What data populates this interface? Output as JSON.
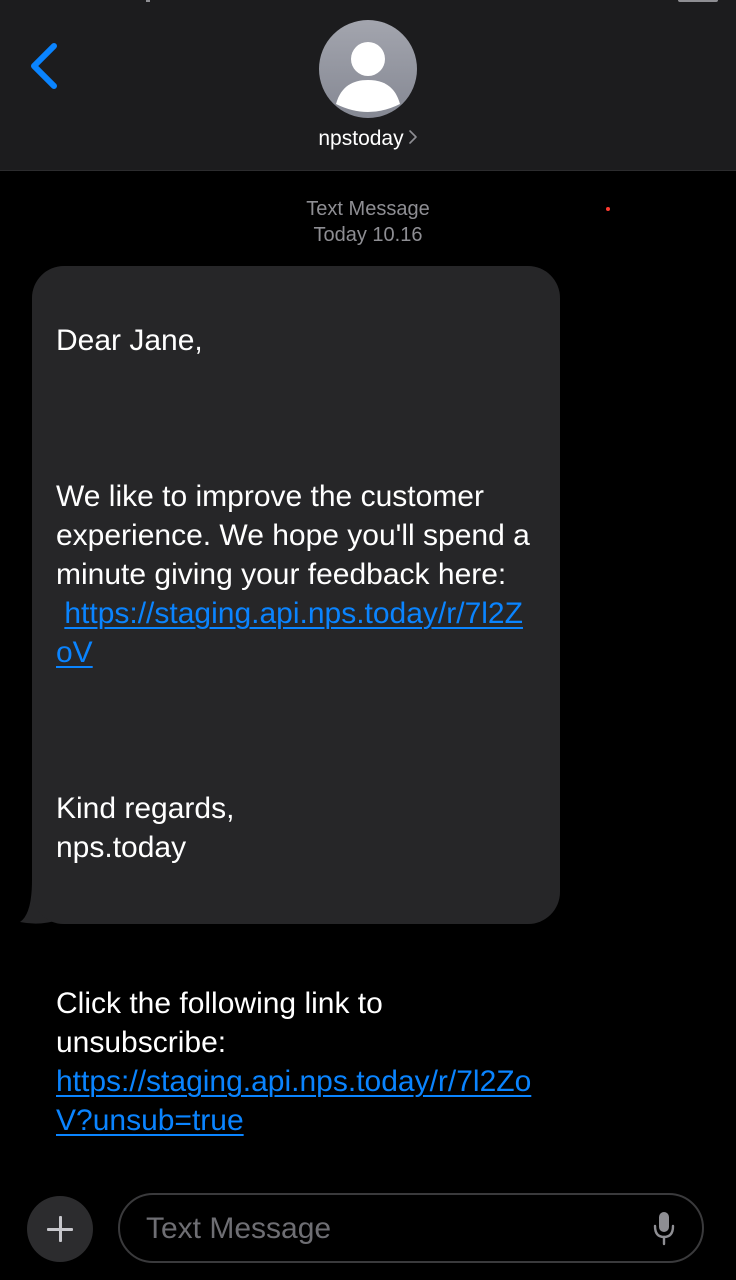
{
  "header": {
    "contact_name": "npstoday",
    "back_icon": "chevron-left-icon",
    "avatar_icon": "person-silhouette-icon",
    "name_chevron_icon": "chevron-right-icon"
  },
  "thread": {
    "service_label": "Text Message",
    "timestamp": "Today 10.16"
  },
  "message": {
    "greeting": "Dear Jane,",
    "body": "We like to improve the customer experience. We hope you'll spend a minute giving your feedback here:",
    "survey_link": "https://staging.api.nps.today/r/7l2ZoV",
    "signoff_line1": "Kind regards,",
    "signoff_line2": "nps.today",
    "unsubscribe_text": "Click the following link to unsubscribe:",
    "unsubscribe_link": "https://staging.api.nps.today/r/7l2ZoV?unsub=true"
  },
  "composer": {
    "placeholder": "Text Message",
    "value": "",
    "plus_icon": "plus-icon",
    "mic_icon": "microphone-icon"
  },
  "colors": {
    "link": "#0a84ff",
    "bubble": "#262628",
    "header": "#1c1c1e",
    "timestamp": "#8e8e93"
  }
}
